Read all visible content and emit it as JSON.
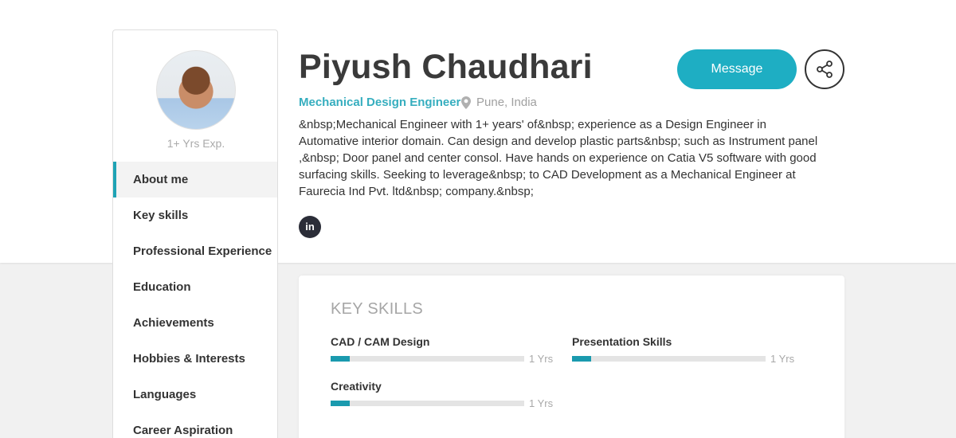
{
  "profile": {
    "name": "Piyush Chaudhari",
    "role": "Mechanical Design Engineer",
    "location": "Pune, India",
    "experience": "1+ Yrs Exp.",
    "about": "&nbsp;Mechanical Engineer with 1+ years' of&nbsp; experience as a Design Engineer in Automative interior domain. Can design and develop plastic parts&nbsp; such as Instrument panel ,&nbsp; Door panel and center consol. Have hands on experience on Catia V5 software with good surfacing skills. Seeking to leverage&nbsp; to CAD Development as a Mechanical Engineer at Faurecia Ind Pvt. ltd&nbsp; company.&nbsp;",
    "linkedin_label": "in"
  },
  "actions": {
    "message_label": "Message",
    "share_icon": "share-icon"
  },
  "sidebar": {
    "items": [
      {
        "label": "About me",
        "active": true
      },
      {
        "label": "Key skills"
      },
      {
        "label": "Professional Experience"
      },
      {
        "label": "Education"
      },
      {
        "label": "Achievements"
      },
      {
        "label": "Hobbies & Interests"
      },
      {
        "label": "Languages"
      },
      {
        "label": "Career Aspiration"
      }
    ]
  },
  "skills": {
    "title": "KEY SKILLS",
    "items": [
      {
        "name": "CAD / CAM Design",
        "years": "1 Yrs",
        "level": 0.1
      },
      {
        "name": "Presentation Skills",
        "years": "1 Yrs",
        "level": 0.1
      },
      {
        "name": "Creativity",
        "years": "1 Yrs",
        "level": 0.1
      }
    ]
  },
  "colors": {
    "accent": "#1eaec3",
    "skill_bar": "#1a9aae",
    "active_border": "#1fa3b5"
  }
}
